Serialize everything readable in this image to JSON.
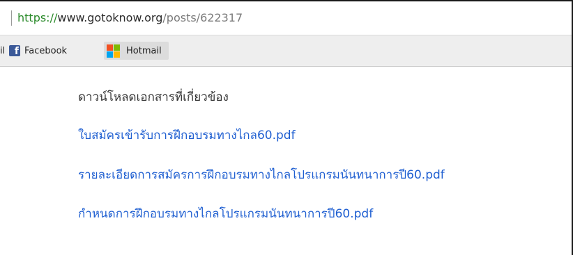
{
  "address_bar": {
    "scheme": "https://",
    "host": "www.gotoknow.org",
    "path": "/posts/622317"
  },
  "bookmarks": {
    "partial_label": "il",
    "items": [
      {
        "label": "Facebook",
        "icon": "facebook-icon",
        "icon_glyph": "f",
        "icon_color": "#3b5998"
      },
      {
        "label": "Hotmail",
        "icon": "windows-logo-icon",
        "colors": [
          "#f25022",
          "#7fba00",
          "#00a4ef",
          "#ffb900"
        ]
      }
    ]
  },
  "content": {
    "heading": "ดาวน์โหลดเอกสารที่เกี่ยวข้อง",
    "links": [
      {
        "label": "ใบสมัครเข้ารับการฝึกอบรมทางไกล60.pdf"
      },
      {
        "label": "รายละเอียดการสมัครการฝึกอบรมทางไกลโปรแกรมนันทนาการปี60.pdf"
      },
      {
        "label": "กำหนดการฝึกอบรมทางไกลโปรแกรมนันทนาการปี60.pdf"
      }
    ],
    "link_color": "#1f5fd1"
  }
}
